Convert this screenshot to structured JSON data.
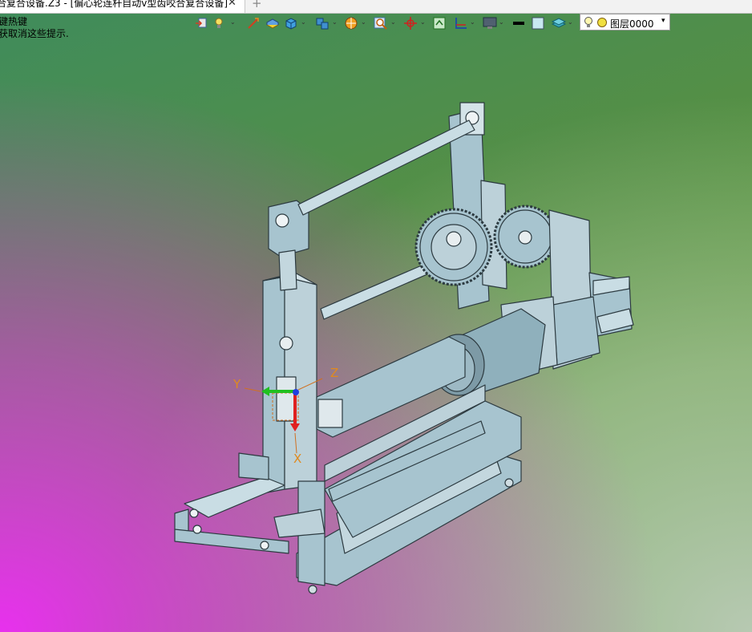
{
  "tab": {
    "title": "合复合设备.Z3 - [偏心轮连杆自动v型齿咬合复合设备]",
    "close": "✕",
    "add": "+"
  },
  "hints": {
    "line1": "键热键",
    "line2": "获取消这些提示."
  },
  "layer": {
    "name": "图层0000",
    "caret": "▾"
  },
  "axes": {
    "x": "X",
    "y": "Y",
    "z": "Z"
  },
  "toolbar_icons": [
    "view-orient-icon",
    "light-icon",
    "sketch-line-icon",
    "shaded-box-icon",
    "solid-cube-icon",
    "blocks-icon",
    "render-ball-icon",
    "zoom-icon",
    "origin-axis-icon",
    "fit-view-icon",
    "section-icon",
    "monitor-icon",
    "line-style-icon",
    "color-swatch-icon",
    "layer-stack-icon"
  ],
  "colors": {
    "model_fill": "#a7c4cf",
    "model_stroke": "#2c3a40",
    "axis_x": "#e02020",
    "axis_y": "#20c020",
    "axis_z": "#2040e0"
  }
}
